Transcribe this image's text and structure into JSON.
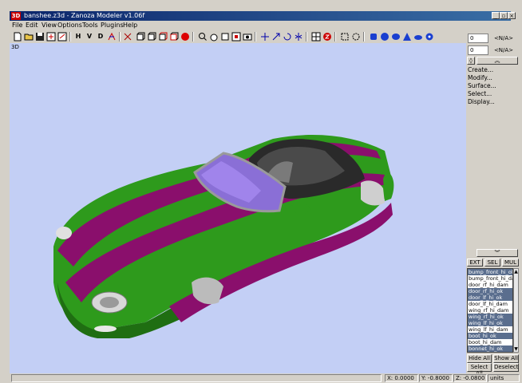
{
  "window": {
    "title": "banshee.z3d - Zanoza Modeler v1.06f",
    "app_icon": "3D"
  },
  "menu": [
    "File",
    "Edit",
    "View",
    "Options",
    "Tools",
    "Plugins",
    "Help"
  ],
  "toolbar": {
    "h_label": "H",
    "v_label": "V",
    "d_label": "D"
  },
  "viewport": {
    "label": "3D",
    "background": "#c3cff5"
  },
  "panel": {
    "spin_1_value": "0",
    "spin_1_label": "<N/A>",
    "spin_2_value": "0",
    "spin_2_label": "<N/A>",
    "commands": [
      "Create...",
      "Modify...",
      "Surface...",
      "Select...",
      "Display..."
    ],
    "tabs": [
      "EXT",
      "SEL",
      "MUL"
    ],
    "objects": [
      {
        "name": "bump_front_hi_ok",
        "selected": true
      },
      {
        "name": "bump_front_hi_dam",
        "selected": false
      },
      {
        "name": "door_rf_hi_dam",
        "selected": false
      },
      {
        "name": "door_rf_hi_ok",
        "selected": true
      },
      {
        "name": "door_lf_hi_ok",
        "selected": true
      },
      {
        "name": "door_lf_hi_dam",
        "selected": false
      },
      {
        "name": "wing_rf_hi_dam",
        "selected": false
      },
      {
        "name": "wing_rf_hi_ok",
        "selected": true
      },
      {
        "name": "wing_lf_hi_ok",
        "selected": true
      },
      {
        "name": "wing_lf_hi_dam",
        "selected": false
      },
      {
        "name": "boot_hi_ok",
        "selected": true
      },
      {
        "name": "boot_hi_dam",
        "selected": false
      },
      {
        "name": "bonnet_hi_ok",
        "selected": true
      }
    ],
    "hide_all": "Hide All",
    "show_all": "Show All",
    "select_all": "Select All",
    "deselect": "Deselect"
  },
  "status": {
    "x": "X: 0.0000",
    "y": "Y: -0.8000",
    "z": "Z: -0.0800",
    "units": "units"
  },
  "colors": {
    "car_green": "#2e9a1c",
    "car_magenta": "#8a0f6c",
    "glass": "#8a6fd6"
  }
}
